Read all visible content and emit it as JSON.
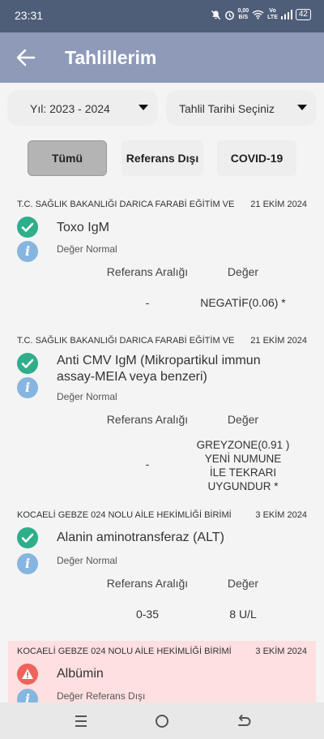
{
  "status_bar": {
    "time": "23:31",
    "net_speed_top": "0,00",
    "net_speed_bottom": "B/S",
    "volte_top": "Vo",
    "volte_bottom": "LTE",
    "battery": "42"
  },
  "header": {
    "title": "Tahlillerim"
  },
  "filters": {
    "year": "Yıl: 2023 - 2024",
    "date": "Tahlil Tarihi Seçiniz"
  },
  "tabs": [
    "Tümü",
    "Referans Dışı",
    "COVID-19"
  ],
  "columns": {
    "reference": "Referans Aralığı",
    "value": "Değer"
  },
  "results": [
    {
      "hospital": "T.C. SAĞLIK BAKANLIĞI DARICA FARABİ EĞİTİM VE",
      "date": "21 EKİM 2024",
      "test": "Toxo IgM",
      "status": "Değer Normal",
      "reference": "-",
      "value": "NEGATİF(0.06) *"
    },
    {
      "hospital": "T.C. SAĞLIK BAKANLIĞI DARICA FARABİ EĞİTİM VE",
      "date": "21 EKİM 2024",
      "test": "Anti CMV IgM (Mikropartikul immun assay-MEIA veya benzeri)",
      "status": "Değer Normal",
      "reference": "-",
      "value": "GREYZONE(0.91 ) YENİ NUMUNE İLE TEKRARI UYGUNDUR *"
    },
    {
      "hospital": "KOCAELİ GEBZE 024 NOLU AİLE HEKİMLİĞİ BİRİMİ",
      "date": "3 EKİM 2024",
      "test": "Alanin aminotransferaz (ALT)",
      "status": "Değer Normal",
      "reference": "0-35",
      "value": "8 U/L"
    },
    {
      "hospital": "KOCAELİ GEBZE 024 NOLU AİLE HEKİMLİĞİ BİRİMİ",
      "date": "3 EKİM 2024",
      "test": "Albümin",
      "status": "Değer Referans Dışı"
    }
  ],
  "colors": {
    "status_bar": "#4e5d78",
    "app_bar": "#8e9ab7",
    "ok": "#2eae8a",
    "warn": "#f0625c",
    "info": "#86b6df",
    "alert_card": "#fde0df"
  }
}
